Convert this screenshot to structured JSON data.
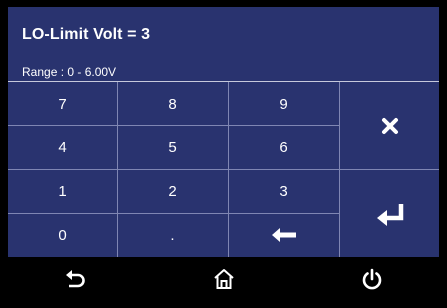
{
  "header": {
    "title": "LO-Limit Volt = 3",
    "range": "Range : 0 - 6.00V"
  },
  "keypad": {
    "keys": [
      [
        "7",
        "8",
        "9"
      ],
      [
        "4",
        "5",
        "6"
      ],
      [
        "1",
        "2",
        "3"
      ],
      [
        "0",
        ".",
        ""
      ]
    ],
    "backspace_icon": "backspace-arrow-icon",
    "clear_icon": "close-icon",
    "enter_icon": "enter-icon"
  },
  "footer": {
    "back_icon": "back-arrow-icon",
    "home_icon": "home-icon",
    "power_icon": "power-icon"
  },
  "colors": {
    "panel": "#29336f",
    "divider": "#7f86b3",
    "text": "#ffffff",
    "background": "#000000"
  }
}
